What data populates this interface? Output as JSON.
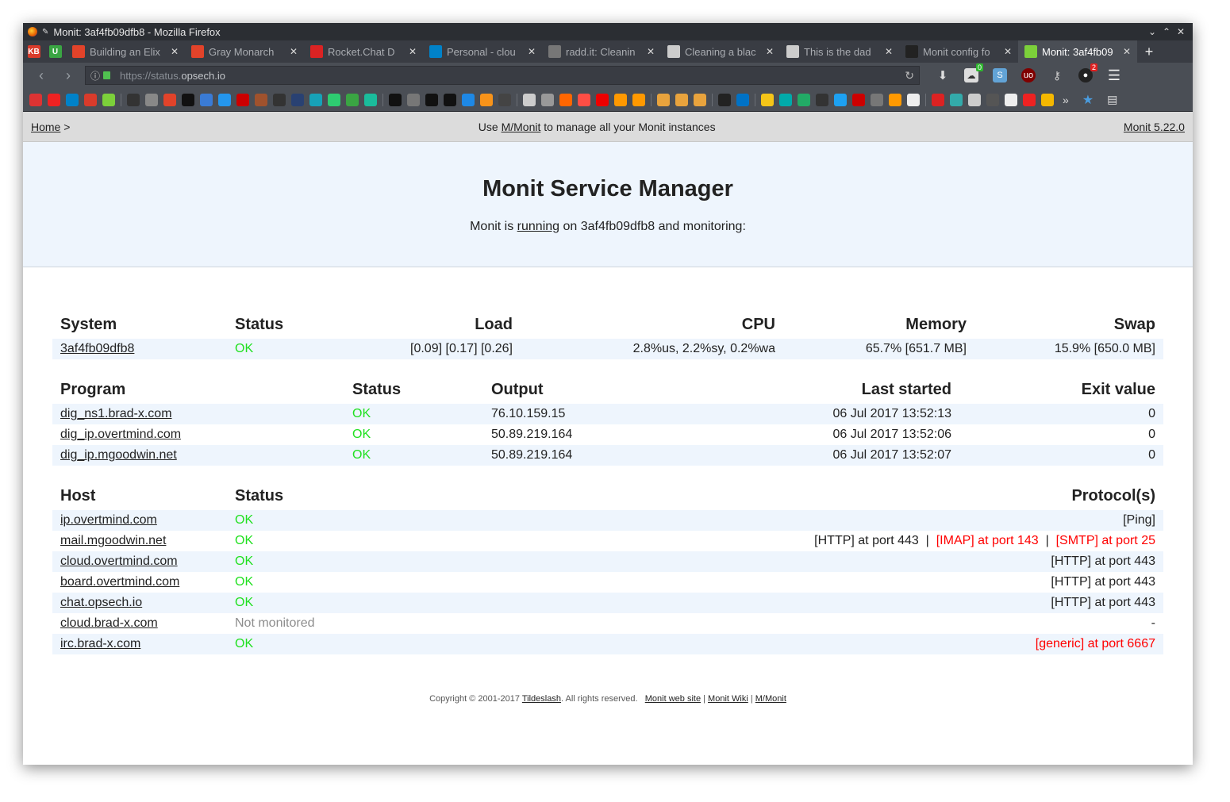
{
  "browser": {
    "window_title": "Monit: 3af4fb09dfb8 - Mozilla Firefox",
    "window_controls": [
      "⌄",
      "⌃",
      "✕"
    ],
    "tabs": [
      {
        "label": "",
        "color": "#d93b2b",
        "glyph": "KB",
        "pinned": true
      },
      {
        "label": "",
        "color": "#3aa543",
        "glyph": "U",
        "pinned": true
      },
      {
        "label": "Building an Elix",
        "color": "#e2432a",
        "glyph": "",
        "pinned": false
      },
      {
        "label": "Gray Monarch",
        "color": "#e2432a",
        "glyph": "",
        "pinned": false
      },
      {
        "label": "Rocket.Chat D",
        "color": "#db2323",
        "glyph": "",
        "pinned": false
      },
      {
        "label": "Personal - clou",
        "color": "#0082c9",
        "glyph": "",
        "pinned": false
      },
      {
        "label": "radd.it: Cleanin",
        "color": "#777777",
        "glyph": "",
        "pinned": false
      },
      {
        "label": "Cleaning a blac",
        "color": "#cccccc",
        "glyph": "",
        "pinned": false
      },
      {
        "label": "This is the dad",
        "color": "#cccccc",
        "glyph": "",
        "pinned": false
      },
      {
        "label": "Monit config fo",
        "color": "#222222",
        "glyph": "",
        "pinned": false
      },
      {
        "label": "Monit: 3af4fb09",
        "color": "#7cd03a",
        "glyph": "",
        "pinned": false,
        "active": true
      }
    ],
    "new_tab_label": "+",
    "url_prefix": "https://status.",
    "url_host": "opsech.io",
    "nav_badges": {
      "green": "0",
      "red": "2"
    }
  },
  "monit": {
    "nav_home": "Home",
    "nav_sep": ">",
    "nav_use": "Use",
    "nav_mmonit": "M/Monit",
    "nav_suffix": "to manage all your Monit instances",
    "nav_version": "Monit 5.22.0",
    "title": "Monit Service Manager",
    "intro_prefix": "Monit is",
    "intro_running": "running",
    "intro_suffix": "on 3af4fb09dfb8 and monitoring:"
  },
  "system_table": {
    "headers": [
      "System",
      "Status",
      "Load",
      "CPU",
      "Memory",
      "Swap"
    ],
    "rows": [
      {
        "name": "3af4fb09dfb8",
        "status": "OK",
        "load": "[0.09] [0.17] [0.26]",
        "cpu": "2.8%us, 2.2%sy, 0.2%wa",
        "memory": "65.7% [651.7 MB]",
        "swap": "15.9% [650.0 MB]"
      }
    ]
  },
  "program_table": {
    "headers": [
      "Program",
      "Status",
      "Output",
      "Last started",
      "Exit value"
    ],
    "rows": [
      {
        "name": "dig_ns1.brad-x.com",
        "status": "OK",
        "output": "76.10.159.15",
        "last_started": "06 Jul 2017 13:52:13",
        "exit": "0"
      },
      {
        "name": "dig_ip.overtmind.com",
        "status": "OK",
        "output": "50.89.219.164",
        "last_started": "06 Jul 2017 13:52:06",
        "exit": "0"
      },
      {
        "name": "dig_ip.mgoodwin.net",
        "status": "OK",
        "output": "50.89.219.164",
        "last_started": "06 Jul 2017 13:52:07",
        "exit": "0"
      }
    ]
  },
  "host_table": {
    "headers": [
      "Host",
      "Status",
      "Protocol(s)"
    ],
    "rows": [
      {
        "name": "ip.overtmind.com",
        "status": "OK",
        "status_class": "ok",
        "protocols": [
          {
            "text": "[Ping]",
            "error": false
          }
        ]
      },
      {
        "name": "mail.mgoodwin.net",
        "status": "OK",
        "status_class": "ok",
        "protocols": [
          {
            "text": "[HTTP] at port 443",
            "error": false
          },
          {
            "text": "[IMAP] at port 143",
            "error": true
          },
          {
            "text": "[SMTP] at port 25",
            "error": true
          }
        ]
      },
      {
        "name": "cloud.overtmind.com",
        "status": "OK",
        "status_class": "ok",
        "protocols": [
          {
            "text": "[HTTP] at port 443",
            "error": false
          }
        ]
      },
      {
        "name": "board.overtmind.com",
        "status": "OK",
        "status_class": "ok",
        "protocols": [
          {
            "text": "[HTTP] at port 443",
            "error": false
          }
        ]
      },
      {
        "name": "chat.opsech.io",
        "status": "OK",
        "status_class": "ok",
        "protocols": [
          {
            "text": "[HTTP] at port 443",
            "error": false
          }
        ]
      },
      {
        "name": "cloud.brad-x.com",
        "status": "Not monitored",
        "status_class": "nm",
        "protocols": [
          {
            "text": "-",
            "error": false
          }
        ]
      },
      {
        "name": "irc.brad-x.com",
        "status": "OK",
        "status_class": "ok",
        "protocols": [
          {
            "text": "[generic] at port 6667",
            "error": true
          }
        ]
      }
    ],
    "protocol_separator": "|"
  },
  "footer": {
    "copyright": "Copyright © 2001-2017",
    "company": "Tildeslash",
    "rights": ". All rights reserved.",
    "web_site": "Monit web site",
    "wiki": "Monit Wiki",
    "mmonit": "M/Monit",
    "sep": "|"
  },
  "colors": {
    "ok": "#20e020",
    "error": "#ff0000",
    "not_monitored": "#8c8c8c",
    "row_stripe": "#eef5fd"
  }
}
